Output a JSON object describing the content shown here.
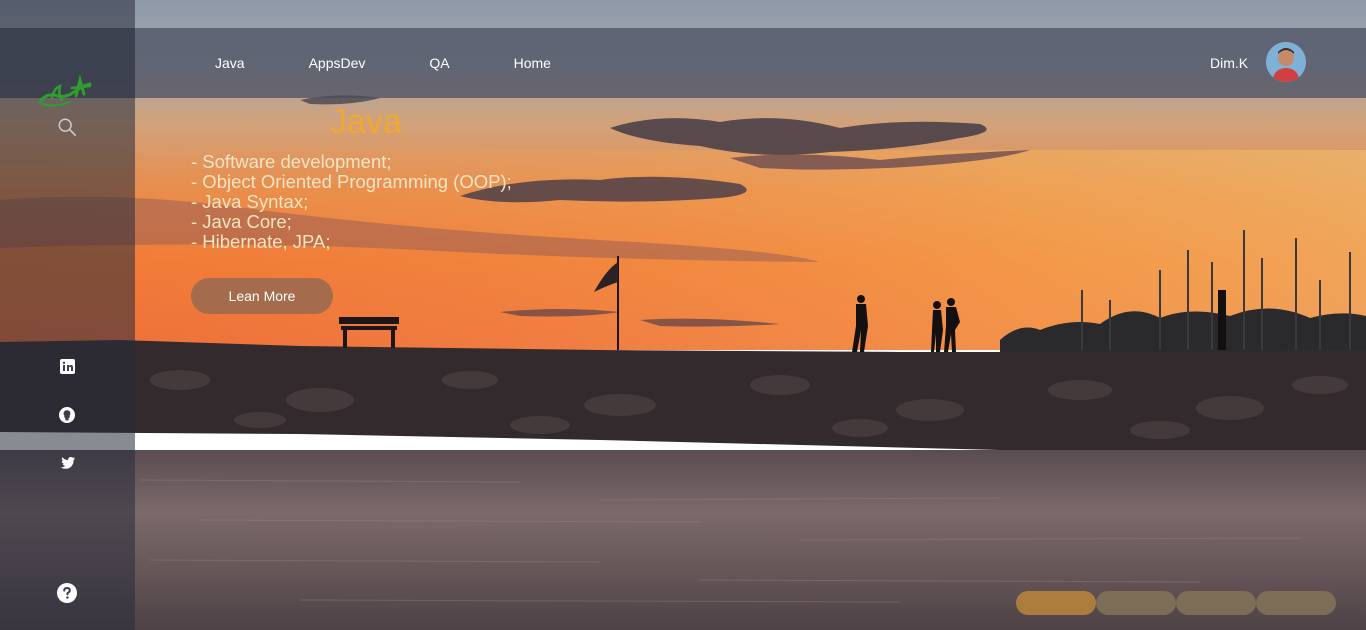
{
  "nav": {
    "items": [
      {
        "label": "Java"
      },
      {
        "label": "AppsDev"
      },
      {
        "label": "QA"
      },
      {
        "label": "Home"
      }
    ]
  },
  "user": {
    "name": "Dim.K"
  },
  "hero": {
    "title": "Java",
    "items": [
      "- Software development;",
      "- Object Oriented Programming (OOP);",
      "- Java Syntax;",
      "- Java Core;",
      "- Hibernate, JPA;"
    ],
    "button_label": "Lean More"
  },
  "sidebar": {
    "icons": [
      "search-icon",
      "linkedin-icon",
      "github-icon",
      "twitter-icon",
      "help-icon"
    ]
  },
  "slider": {
    "slides": 4,
    "active_index": 0
  },
  "colors": {
    "title_accent": "#f0a830",
    "logo_green": "#2e9e2e",
    "active_pill": "#c08a3a",
    "inactive_pill": "#8a7a5c"
  }
}
